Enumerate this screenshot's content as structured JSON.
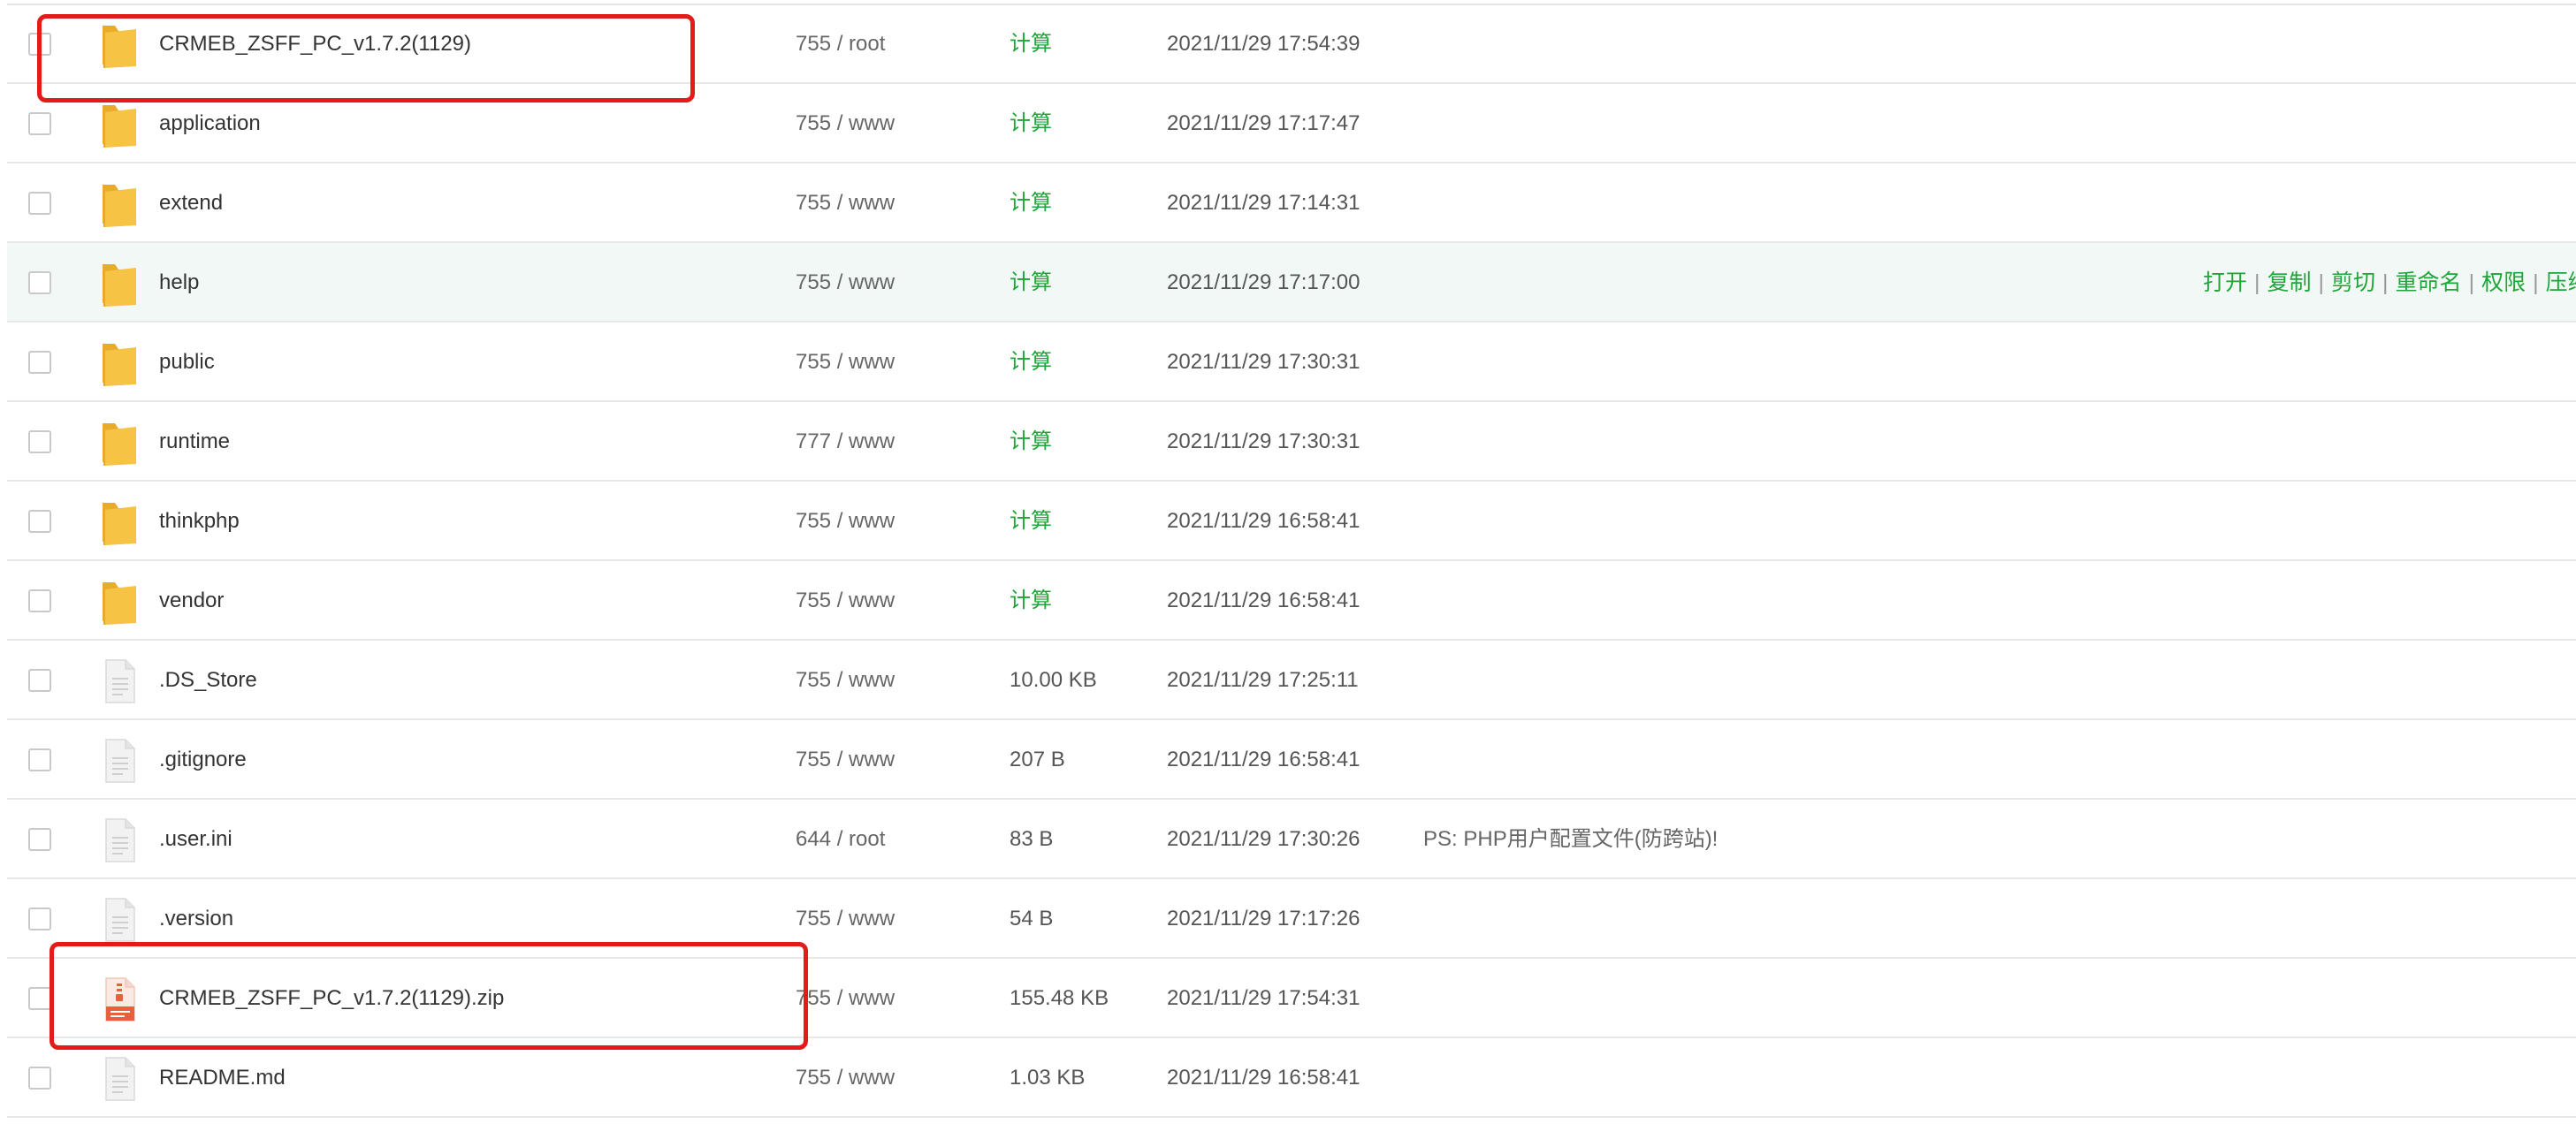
{
  "files": [
    {
      "name": "CRMEB_ZSFF_PC_v1.7.2(1129)",
      "type": "folder",
      "permission": "755 / root",
      "size": "计算",
      "modified": "2021/11/29 17:54:39",
      "note": "",
      "highlighted": true
    },
    {
      "name": "application",
      "type": "folder",
      "permission": "755 / www",
      "size": "计算",
      "modified": "2021/11/29 17:17:47",
      "note": ""
    },
    {
      "name": "extend",
      "type": "folder",
      "permission": "755 / www",
      "size": "计算",
      "modified": "2021/11/29 17:14:31",
      "note": ""
    },
    {
      "name": "help",
      "type": "folder",
      "permission": "755 / www",
      "size": "计算",
      "modified": "2021/11/29 17:17:00",
      "note": "",
      "selected": true
    },
    {
      "name": "public",
      "type": "folder",
      "permission": "755 / www",
      "size": "计算",
      "modified": "2021/11/29 17:30:31",
      "note": ""
    },
    {
      "name": "runtime",
      "type": "folder",
      "permission": "777 / www",
      "size": "计算",
      "modified": "2021/11/29 17:30:31",
      "note": ""
    },
    {
      "name": "thinkphp",
      "type": "folder",
      "permission": "755 / www",
      "size": "计算",
      "modified": "2021/11/29 16:58:41",
      "note": ""
    },
    {
      "name": "vendor",
      "type": "folder",
      "permission": "755 / www",
      "size": "计算",
      "modified": "2021/11/29 16:58:41",
      "note": ""
    },
    {
      "name": ".DS_Store",
      "type": "file",
      "permission": "755 / www",
      "size": "10.00 KB",
      "modified": "2021/11/29 17:25:11",
      "note": ""
    },
    {
      "name": ".gitignore",
      "type": "file",
      "permission": "755 / www",
      "size": "207 B",
      "modified": "2021/11/29 16:58:41",
      "note": ""
    },
    {
      "name": ".user.ini",
      "type": "file",
      "permission": "644 / root",
      "size": "83 B",
      "modified": "2021/11/29 17:30:26",
      "note": "PS: PHP用户配置文件(防跨站)!"
    },
    {
      "name": ".version",
      "type": "file",
      "permission": "755 / www",
      "size": "54 B",
      "modified": "2021/11/29 17:17:26",
      "note": ""
    },
    {
      "name": "CRMEB_ZSFF_PC_v1.7.2(1129).zip",
      "type": "zip",
      "permission": "755 / www",
      "size": "155.48 KB",
      "modified": "2021/11/29 17:54:31",
      "note": "",
      "highlighted": true
    },
    {
      "name": "README.md",
      "type": "file",
      "permission": "755 / www",
      "size": "1.03 KB",
      "modified": "2021/11/29 16:58:41",
      "note": ""
    }
  ],
  "row_actions": [
    "打开",
    "复制",
    "剪切",
    "重命名",
    "权限",
    "压缩"
  ],
  "icons": {
    "folder": "folder-icon",
    "file": "file-icon",
    "zip": "zip-file-icon"
  },
  "colors": {
    "accent": "#20a53a",
    "selected_row": "#f1f8f5",
    "highlight_box": "#e21b1b",
    "folder": "#f6c344"
  }
}
